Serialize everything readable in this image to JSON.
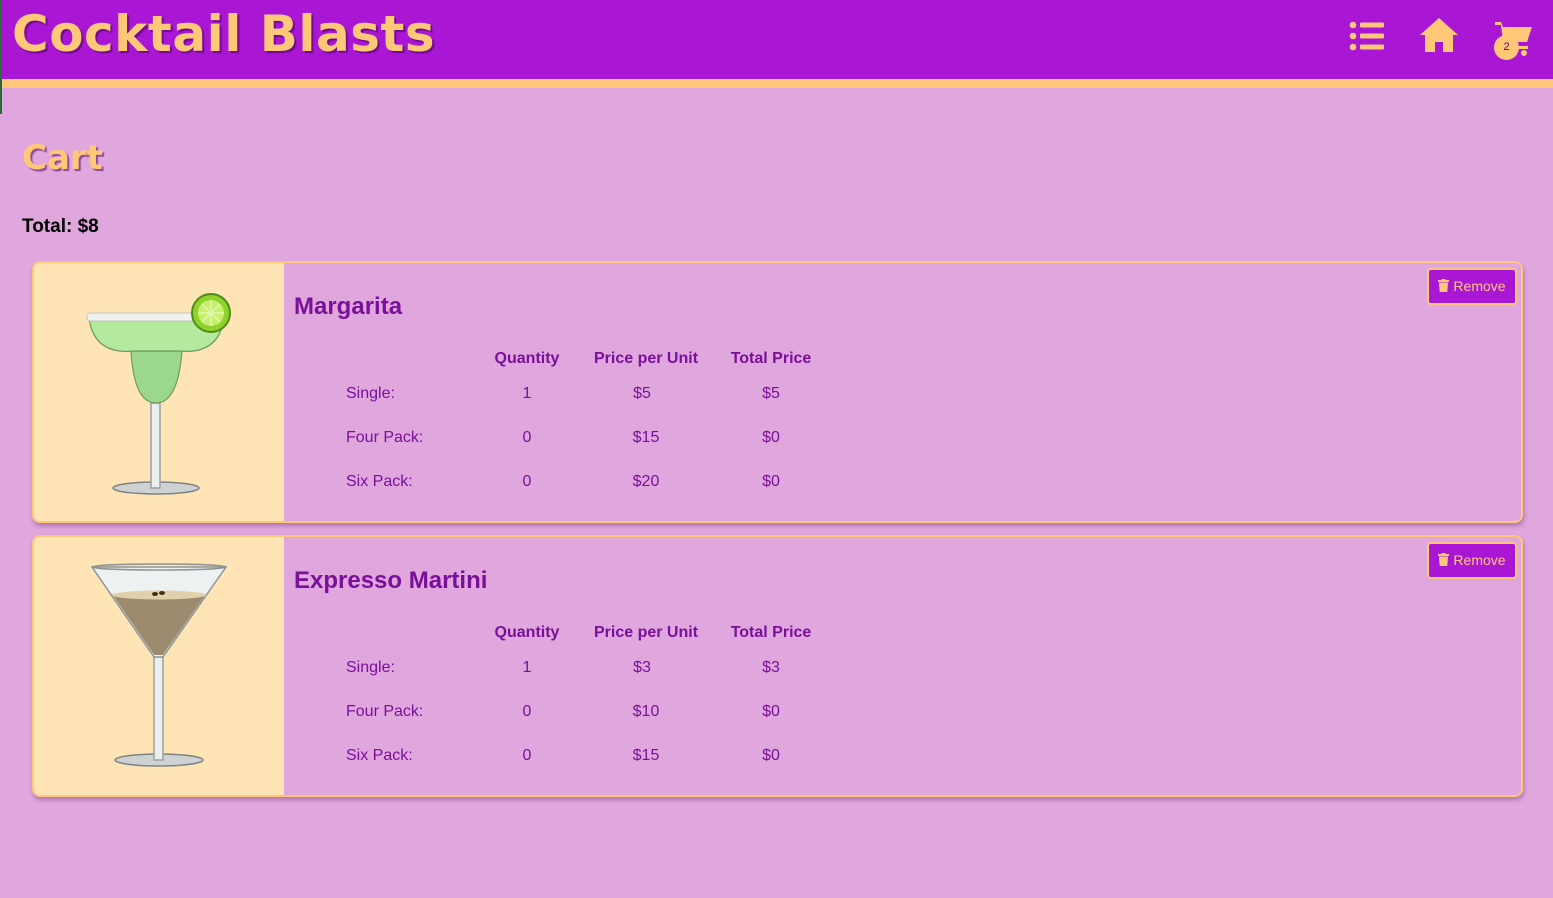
{
  "header": {
    "brand": "Cocktail Blasts",
    "icons": [
      "list-icon",
      "home-icon",
      "cart-icon"
    ],
    "cart_count": "2"
  },
  "colors": {
    "header_bg": "#a917d4",
    "accent": "#ffc878",
    "page_bg": "#e0a6de",
    "text_purple": "#7a0f9a",
    "image_bg": "#ffe4b6"
  },
  "cart": {
    "title": "Cart",
    "total_label": "Total: $8",
    "columns": {
      "quantity": "Quantity",
      "price_per_unit": "Price per Unit",
      "total_price": "Total Price"
    },
    "remove_label": "Remove",
    "items": [
      {
        "name": "Margarita",
        "image": "margarita-glass",
        "rows": [
          {
            "label": "Single:",
            "quantity": "1",
            "price": "$5",
            "total": "$5"
          },
          {
            "label": "Four Pack:",
            "quantity": "0",
            "price": "$15",
            "total": "$0"
          },
          {
            "label": "Six Pack:",
            "quantity": "0",
            "price": "$20",
            "total": "$0"
          }
        ]
      },
      {
        "name": "Expresso Martini",
        "image": "martini-glass",
        "rows": [
          {
            "label": "Single:",
            "quantity": "1",
            "price": "$3",
            "total": "$3"
          },
          {
            "label": "Four Pack:",
            "quantity": "0",
            "price": "$10",
            "total": "$0"
          },
          {
            "label": "Six Pack:",
            "quantity": "0",
            "price": "$15",
            "total": "$0"
          }
        ]
      }
    ]
  }
}
